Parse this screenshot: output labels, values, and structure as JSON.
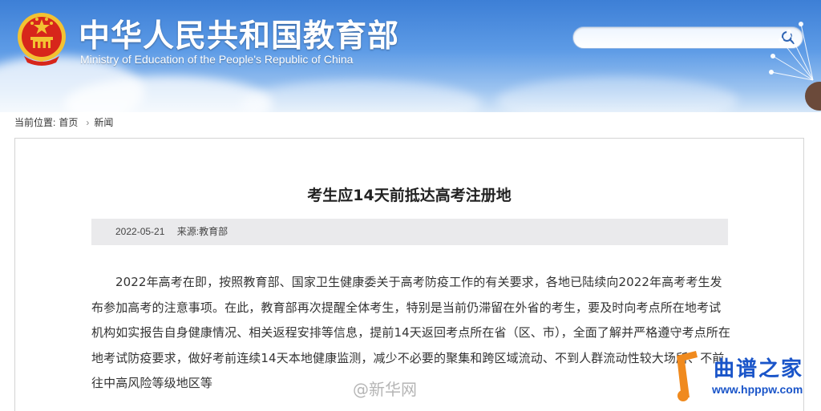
{
  "header": {
    "title_cn": "中华人民共和国教育部",
    "title_en": "Ministry of Education of the People's Republic of China",
    "search_placeholder": ""
  },
  "breadcrumb": {
    "label": "当前位置:",
    "items": [
      "首页",
      "新闻"
    ]
  },
  "article": {
    "title": "考生应14天前抵达高考注册地",
    "date": "2022-05-21",
    "source": "来源:教育部",
    "body": "2022年高考在即，按照教育部、国家卫生健康委关于高考防疫工作的有关要求，各地已陆续向2022年高考考生发布参加高考的注意事项。在此，教育部再次提醒全体考生，特别是当前仍滞留在外省的考生，要及时向考点所在地考试机构如实报告自身健康情况、相关返程安排等信息，提前14天返回考点所在省（区、市），全面了解并严格遵守考点所在地考试防疫要求，做好考前连续14天本地健康监测，减少不必要的聚集和跨区域流动、不到人群流动性较大场所、不前往中高风险等级地区等"
  },
  "watermarks": {
    "weibo": "@新华网",
    "site_cn": "曲谱之家",
    "site_url": "www.hpppw.com"
  },
  "colors": {
    "header_blue": "#3d7fd6",
    "emblem_red": "#d7261b",
    "emblem_gold": "#f3c232",
    "watermark_blue": "#1a55c9",
    "watermark_orange": "#f08a1e"
  }
}
